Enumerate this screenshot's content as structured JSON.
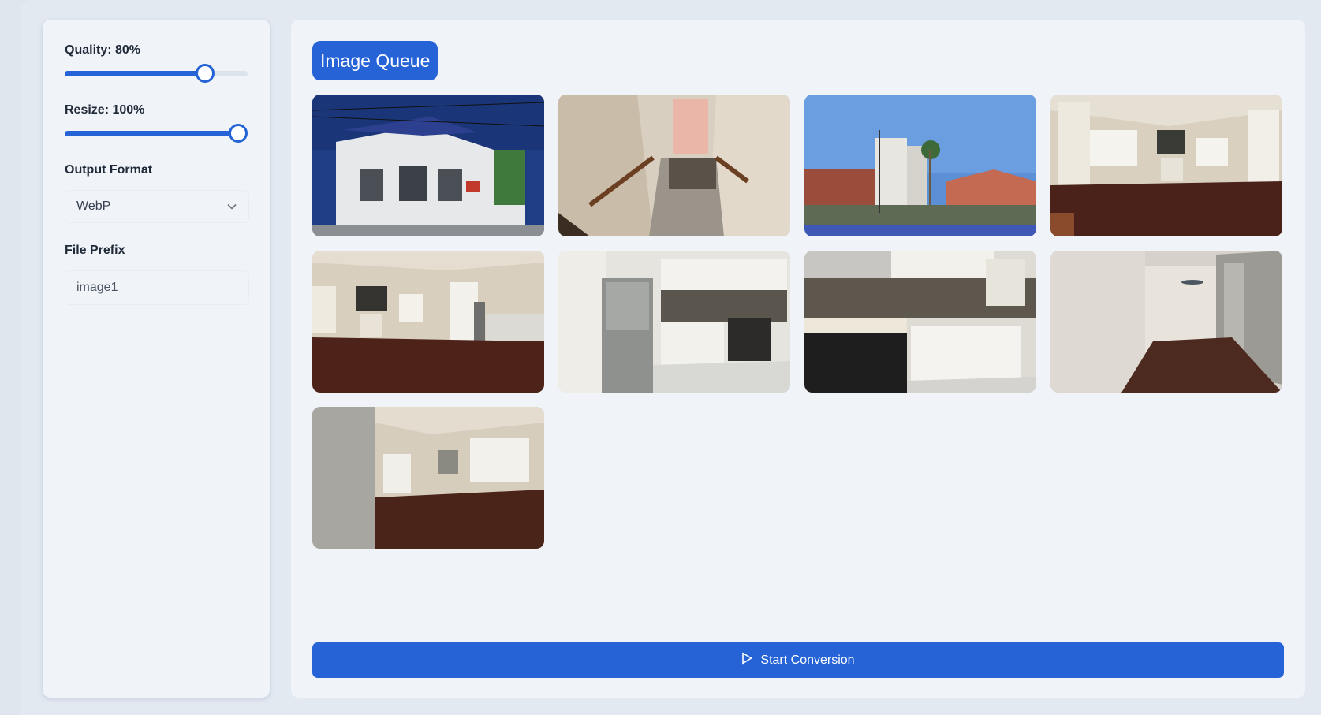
{
  "settings": {
    "quality": {
      "label": "Quality: 80%",
      "value": 0.8
    },
    "resize": {
      "label": "Resize: 100%",
      "value": 1.0
    },
    "output_format": {
      "label": "Output Format",
      "selected": "WebP"
    },
    "file_prefix": {
      "label": "File Prefix",
      "value": "image1"
    }
  },
  "queue": {
    "title": "Image Queue",
    "images": [
      {
        "subject": "house-exterior"
      },
      {
        "subject": "staircase"
      },
      {
        "subject": "street-view"
      },
      {
        "subject": "living-room"
      },
      {
        "subject": "living-room-kitchen"
      },
      {
        "subject": "kitchen-fridge"
      },
      {
        "subject": "kitchen-stove"
      },
      {
        "subject": "empty-room"
      },
      {
        "subject": "living-room-windows"
      }
    ]
  },
  "actions": {
    "start_label": "Start Conversion",
    "start_icon": "play-icon"
  },
  "colors": {
    "accent": "#2563d6",
    "panel": "#f0f4f9",
    "background": "#dfe6ee"
  }
}
